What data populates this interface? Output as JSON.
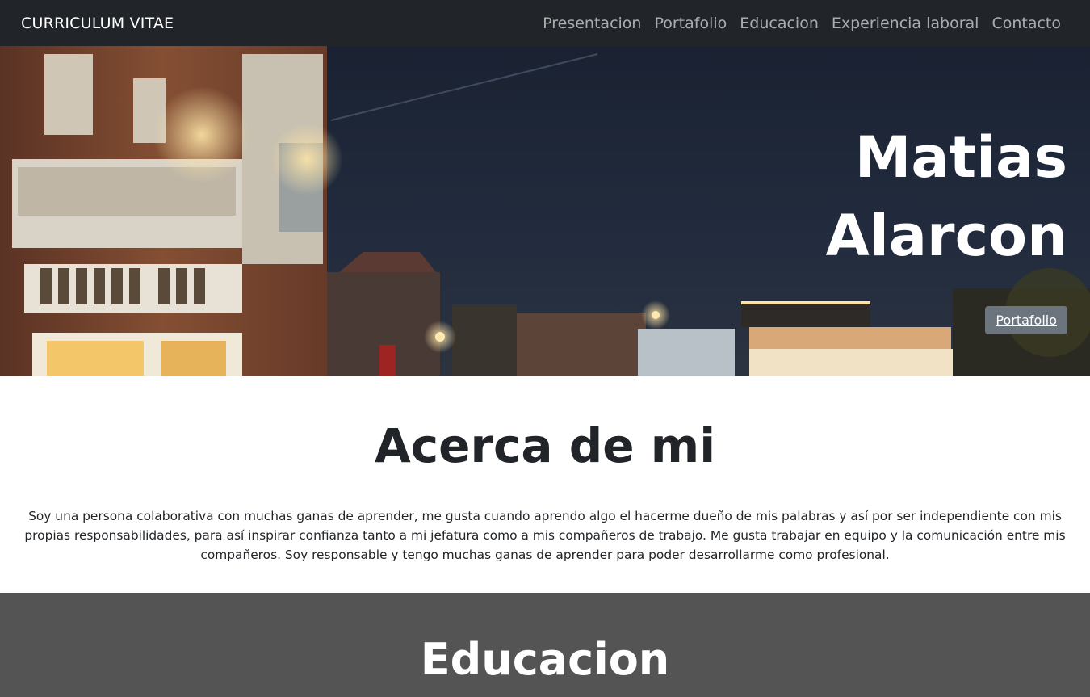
{
  "nav": {
    "brand": "CURRICULUM VITAE",
    "links": [
      "Presentacion",
      "Portafolio",
      "Educacion",
      "Experiencia laboral",
      "Contacto"
    ]
  },
  "hero": {
    "first_name": "Matias",
    "last_name": "Alarcon",
    "button_label": "Portafolio"
  },
  "about": {
    "title": "Acerca de mi",
    "text": "Soy una persona colaborativa con muchas ganas de aprender, me gusta cuando aprendo algo el hacerme dueño de mis palabras y así por ser independiente con mis propias responsabilidades, para así inspirar confianza tanto a mi jefatura como a mis compañeros de trabajo. Me gusta trabajar en equipo y la comunicación entre mis compañeros. Soy responsable y tengo muchas ganas de aprender para poder desarrollarme como profesional."
  },
  "education": {
    "title": "Educacion"
  },
  "colors": {
    "navbar": "#212529",
    "education_bg": "#555455",
    "button": "#6c757d"
  }
}
